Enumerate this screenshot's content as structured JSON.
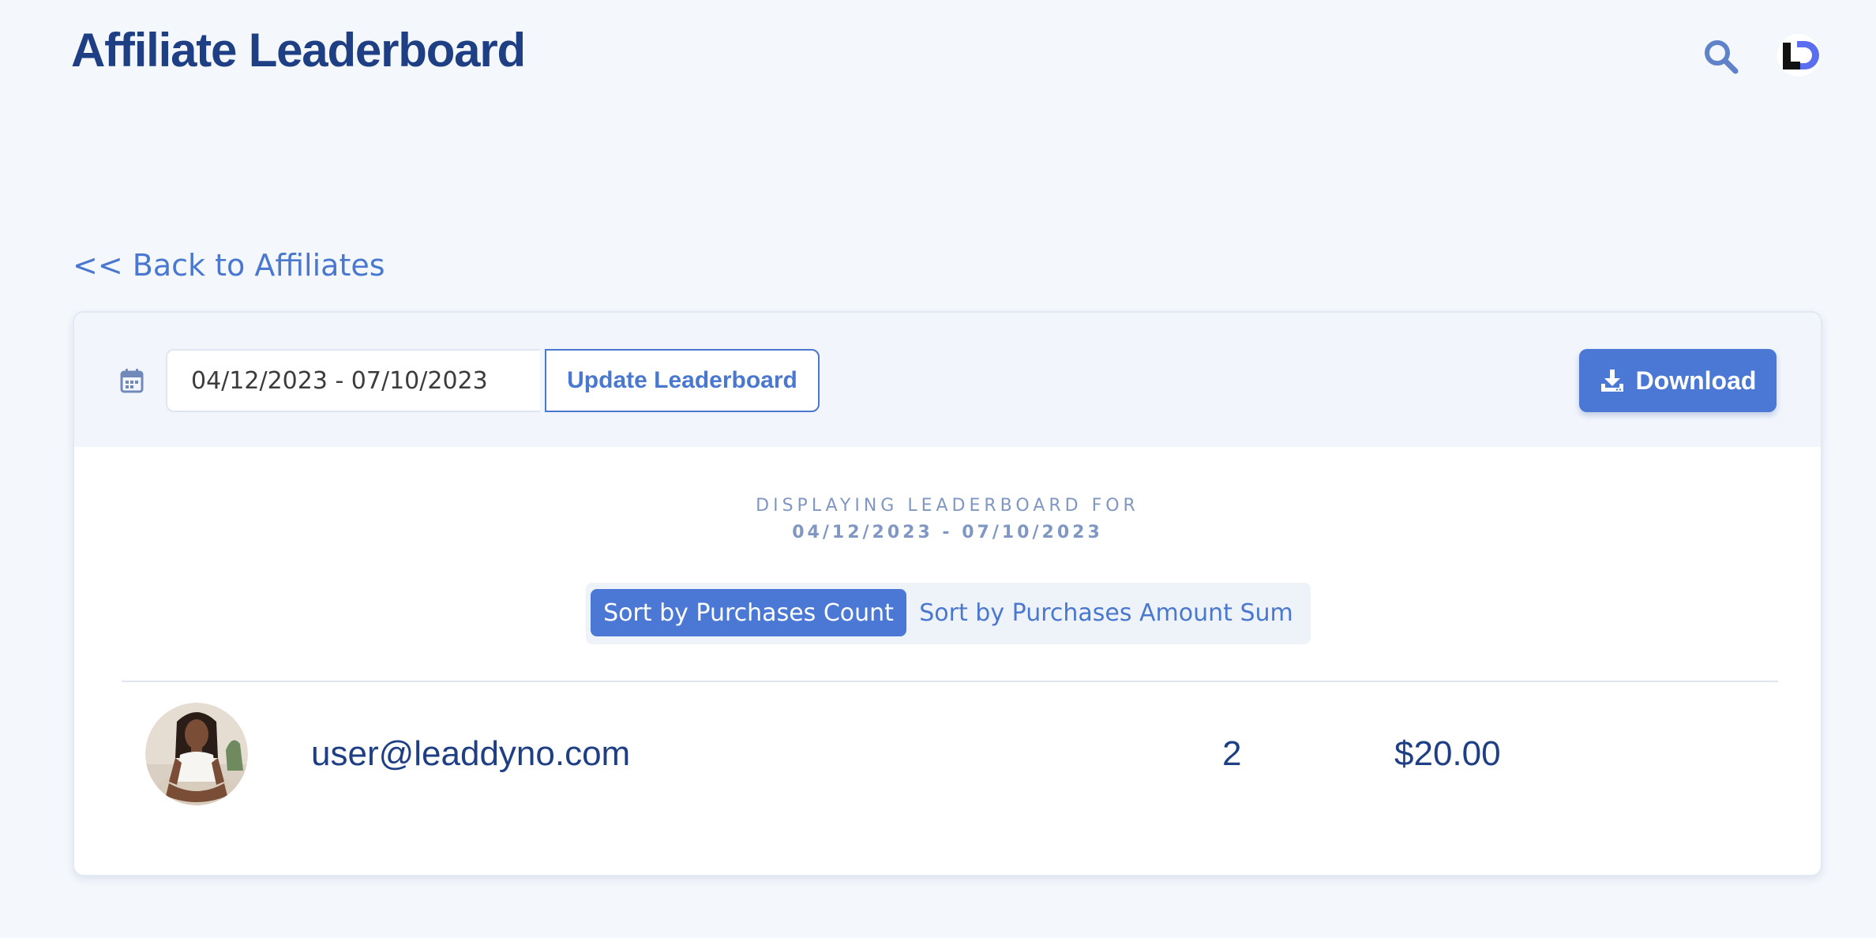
{
  "header": {
    "title": "Affiliate Leaderboard"
  },
  "nav": {
    "back_label": "<< Back to Affiliates"
  },
  "toolbar": {
    "date_range_value": "04/12/2023 - 07/10/2023",
    "update_label": "Update Leaderboard",
    "download_label": "Download"
  },
  "display": {
    "label": "DISPLAYING LEADERBOARD FOR",
    "range": "04/12/2023 - 07/10/2023"
  },
  "sort": {
    "options": [
      {
        "label": "Sort by Purchases Count",
        "active": true
      },
      {
        "label": "Sort by Purchases Amount Sum",
        "active": false
      }
    ]
  },
  "leaderboard": {
    "rows": [
      {
        "email": "user@leaddyno.com",
        "purchases_count": "2",
        "purchases_amount": "$20.00"
      }
    ]
  },
  "colors": {
    "accent": "#4a78d4",
    "title": "#1f3f84",
    "background": "#f4f7fc"
  },
  "icons": [
    "search-icon",
    "leaddyno-logo",
    "calendar-icon",
    "download-icon"
  ]
}
